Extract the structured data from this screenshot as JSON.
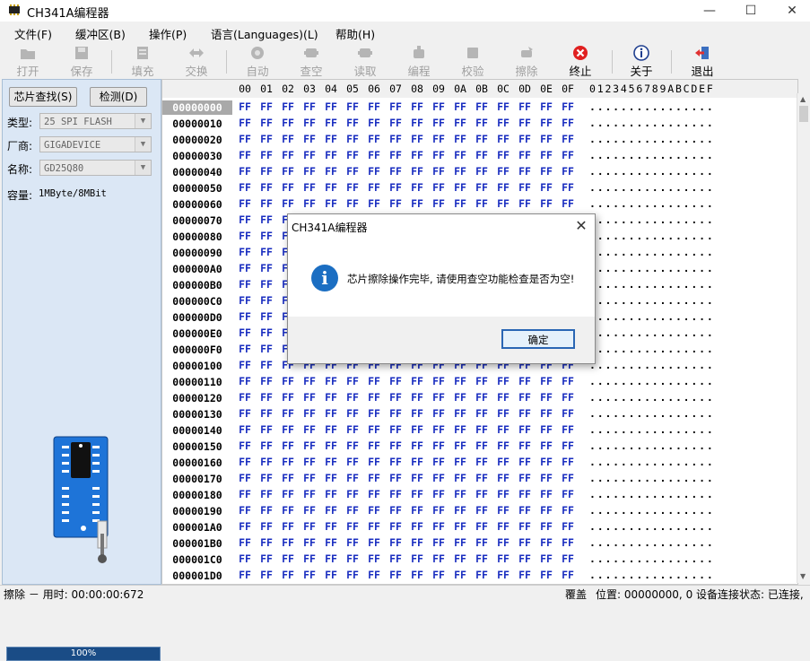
{
  "window": {
    "title": "CH341A编程器",
    "minimize": "—",
    "maximize": "☐",
    "close": "✕"
  },
  "menu": [
    "文件(F)",
    "缓冲区(B)",
    "操作(P)",
    "语言(Languages)(L)",
    "帮助(H)"
  ],
  "toolbar": [
    {
      "label": "打开",
      "icon": "open-folder-icon",
      "enabled": false
    },
    {
      "label": "保存",
      "icon": "save-disk-icon",
      "enabled": false
    },
    {
      "label": "填充",
      "icon": "fill-icon",
      "enabled": false
    },
    {
      "label": "交换",
      "icon": "swap-arrows-icon",
      "enabled": false
    },
    {
      "label": "自动",
      "icon": "auto-gear-icon",
      "enabled": false
    },
    {
      "label": "查空",
      "icon": "chip-check-blank-icon",
      "enabled": false
    },
    {
      "label": "读取",
      "icon": "chip-read-icon",
      "enabled": false
    },
    {
      "label": "编程",
      "icon": "chip-program-icon",
      "enabled": false
    },
    {
      "label": "校验",
      "icon": "chip-verify-icon",
      "enabled": false
    },
    {
      "label": "擦除",
      "icon": "eraser-icon",
      "enabled": false
    },
    {
      "label": "终止",
      "icon": "stop-x-icon",
      "enabled": true
    },
    {
      "label": "关于",
      "icon": "info-about-icon",
      "enabled": true
    },
    {
      "label": "退出",
      "icon": "exit-door-icon",
      "enabled": true
    }
  ],
  "left_panel": {
    "find_chip_button": "芯片查找(S)",
    "detect_button": "检测(D)",
    "type_label": "类型:",
    "type_value": "25 SPI FLASH",
    "vendor_label": "厂商:",
    "vendor_value": "GIGADEVICE",
    "name_label": "名称:",
    "name_value": "GD25Q80",
    "capacity_label": "容量:",
    "capacity_value": "1MByte/8MBit",
    "progress_text": "100%",
    "progress_value": 1.0
  },
  "hex": {
    "columns": [
      "00",
      "01",
      "02",
      "03",
      "04",
      "05",
      "06",
      "07",
      "08",
      "09",
      "0A",
      "0B",
      "0C",
      "0D",
      "0E",
      "0F"
    ],
    "ascii_header": "0123456789ABCDEF",
    "fill_byte": "FF",
    "ascii_row": "................",
    "addresses": [
      "00000000",
      "00000010",
      "00000020",
      "00000030",
      "00000040",
      "00000050",
      "00000060",
      "00000070",
      "00000080",
      "00000090",
      "000000A0",
      "000000B0",
      "000000C0",
      "000000D0",
      "000000E0",
      "000000F0",
      "00000100",
      "00000110",
      "00000120",
      "00000130",
      "00000140",
      "00000150",
      "00000160",
      "00000170",
      "00000180",
      "00000190",
      "000001A0",
      "000001B0",
      "000001C0",
      "000001D0"
    ],
    "selected_address": "00000000"
  },
  "status": {
    "left": "擦除 － 用时:  00:00:00:672",
    "mode": "覆盖",
    "position": "位置: 00000000, 0",
    "connection": "设备连接状态: 已连接,"
  },
  "dialog": {
    "title": "CH341A编程器",
    "message": "芯片擦除操作完毕, 请使用查空功能检查是否为空!",
    "ok_button": "确定",
    "info_glyph": "i",
    "close": "✕"
  },
  "colors": {
    "hex_byte": "#1a2ec0",
    "left_panel_bg": "#dbe7f5",
    "progress_bg": "#1a4c86",
    "stop_red": "#e02020",
    "info_blue": "#1b6ec2"
  }
}
